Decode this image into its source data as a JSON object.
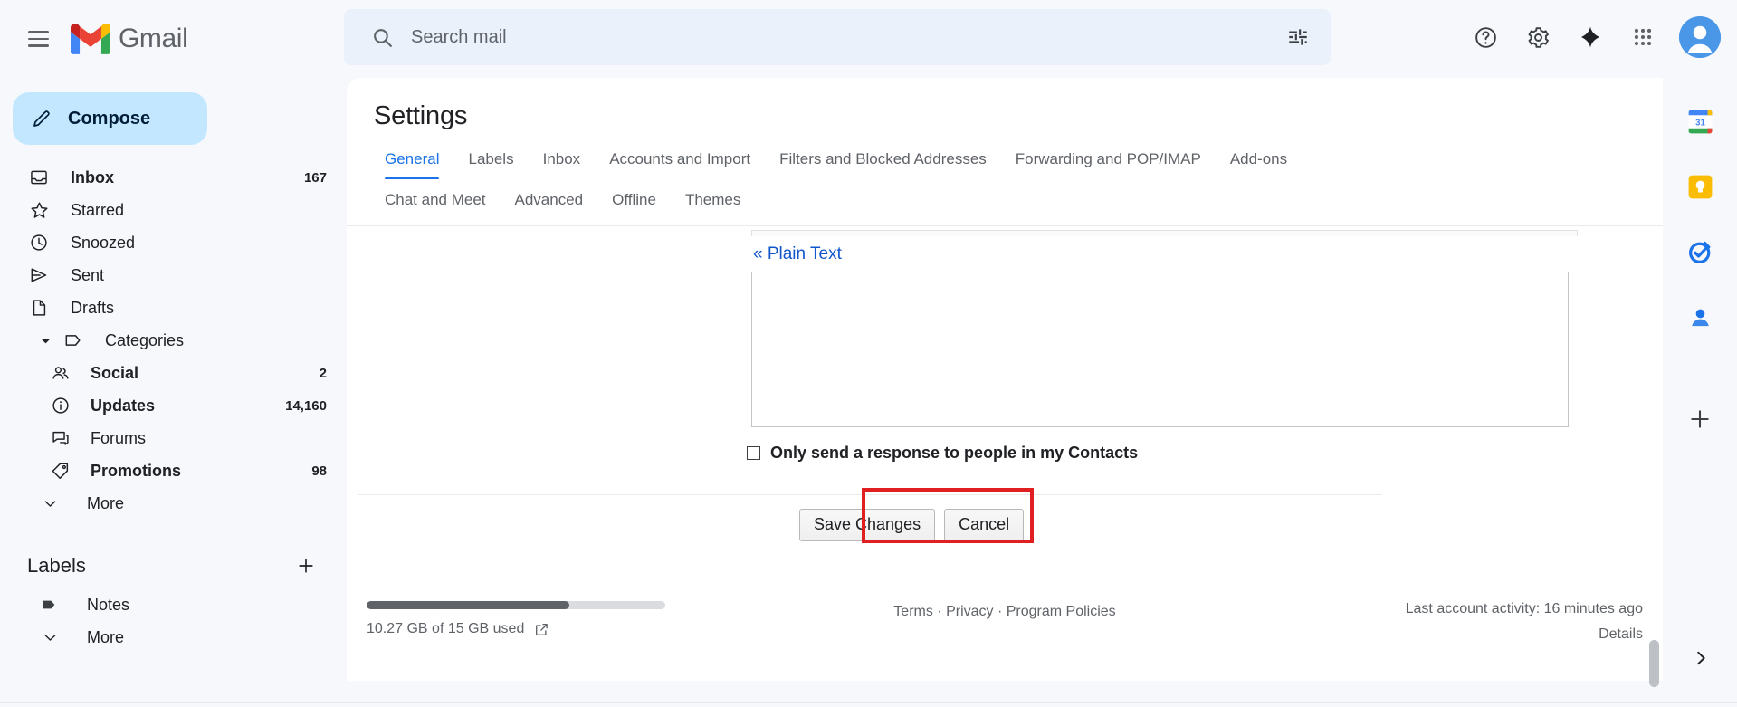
{
  "app": {
    "brand": "Gmail",
    "menu_icon": "hamburger-icon"
  },
  "search": {
    "placeholder": "Search mail",
    "value": "",
    "search_icon": "search-icon",
    "filter_icon": "tune-options-icon"
  },
  "top_right": {
    "help": "help-icon",
    "settings": "gear-icon",
    "gemini": "sparkle-icon",
    "apps": "apps-grid-icon",
    "account": "avatar"
  },
  "sidebar": {
    "compose_label": "Compose",
    "compose_icon": "pencil-icon",
    "items": [
      {
        "label": "Inbox",
        "count": "167",
        "icon": "inbox-icon",
        "bold": true
      },
      {
        "label": "Starred",
        "count": "",
        "icon": "star-icon",
        "bold": false
      },
      {
        "label": "Snoozed",
        "count": "",
        "icon": "clock-icon",
        "bold": false
      },
      {
        "label": "Sent",
        "count": "",
        "icon": "send-icon",
        "bold": false
      },
      {
        "label": "Drafts",
        "count": "",
        "icon": "draft-file-icon",
        "bold": false
      },
      {
        "label": "Categories",
        "count": "",
        "icon": "label-tag-icon",
        "bold": false
      },
      {
        "label": "Social",
        "count": "2",
        "icon": "people-icon",
        "bold": true
      },
      {
        "label": "Updates",
        "count": "14,160",
        "icon": "info-circle-icon",
        "bold": true
      },
      {
        "label": "Forums",
        "count": "",
        "icon": "forum-icon",
        "bold": false
      },
      {
        "label": "Promotions",
        "count": "98",
        "icon": "price-tag-icon",
        "bold": true
      },
      {
        "label": "More",
        "count": "",
        "icon": "chevron-down-icon",
        "bold": false
      }
    ],
    "labels_title": "Labels",
    "add_label_icon": "plus-icon",
    "labels": [
      {
        "label": "Notes",
        "icon": "filled-tag-icon"
      },
      {
        "label": "More",
        "icon": "chevron-down-icon"
      }
    ]
  },
  "main": {
    "title": "Settings",
    "tabs_row1": [
      {
        "label": "General",
        "active": true
      },
      {
        "label": "Labels",
        "active": false
      },
      {
        "label": "Inbox",
        "active": false
      },
      {
        "label": "Accounts and Import",
        "active": false
      },
      {
        "label": "Filters and Blocked Addresses",
        "active": false
      },
      {
        "label": "Forwarding and POP/IMAP",
        "active": false
      },
      {
        "label": "Add-ons",
        "active": false
      }
    ],
    "tabs_row2": [
      {
        "label": "Chat and Meet",
        "active": false
      },
      {
        "label": "Advanced",
        "active": false
      },
      {
        "label": "Offline",
        "active": false
      },
      {
        "label": "Themes",
        "active": false
      }
    ],
    "plain_text_link": "« Plain Text",
    "vacation_message_value": "",
    "contacts_only_label": "Only send a response to people in my Contacts",
    "contacts_only_checked": false,
    "save_label": "Save Changes",
    "cancel_label": "Cancel",
    "highlight_color": "#e02020"
  },
  "footer": {
    "storage_used_percent": 68,
    "storage_text": "10.27 GB of 15 GB used",
    "storage_link_icon": "external-link-icon",
    "legal": [
      "Terms",
      "Privacy",
      "Program Policies"
    ],
    "legal_separator": " · ",
    "last_activity": "Last account activity: 16 minutes ago",
    "details_label": "Details"
  },
  "right_rail": {
    "items": [
      {
        "name": "google-calendar-icon",
        "badge": "31"
      },
      {
        "name": "google-keep-icon",
        "badge": ""
      },
      {
        "name": "google-tasks-icon",
        "badge": ""
      },
      {
        "name": "google-contacts-icon",
        "badge": ""
      }
    ],
    "add_icon": "plus-icon",
    "expand_icon": "chevron-right-icon"
  }
}
